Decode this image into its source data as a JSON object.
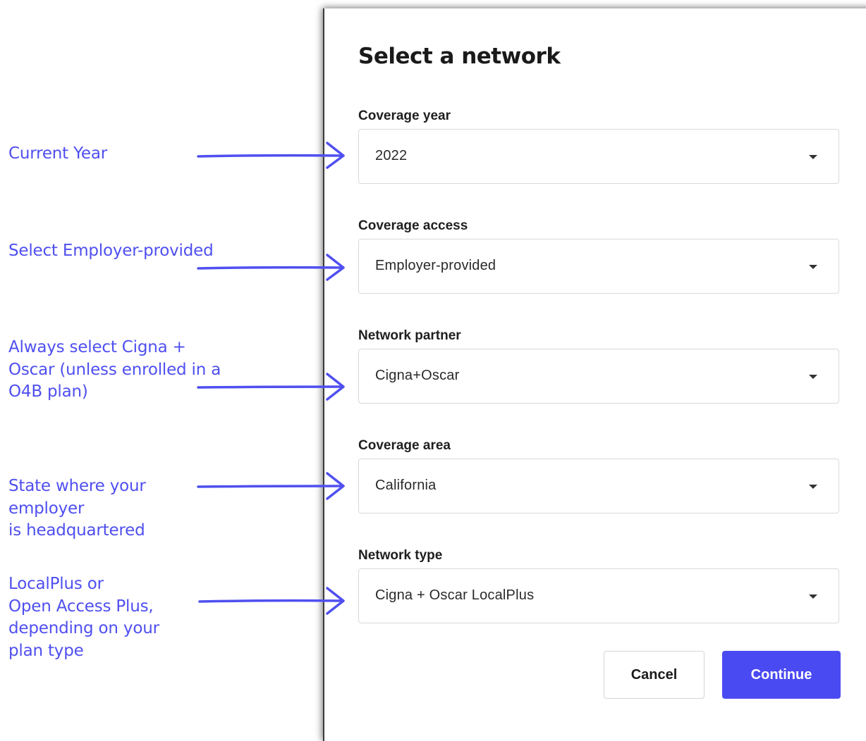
{
  "annotations": [
    {
      "name": "current-year",
      "lines": [
        "Current Year"
      ]
    },
    {
      "name": "employer-provided",
      "lines": [
        "Select Employer-provided"
      ]
    },
    {
      "name": "network-partner",
      "lines": [
        "Always select Cigna  +",
        "Oscar (unless enrolled in a",
        "O4B plan)"
      ]
    },
    {
      "name": "coverage-area",
      "lines": [
        "State where your",
        "employer",
        "is headquartered"
      ]
    },
    {
      "name": "network-type",
      "lines": [
        "LocalPlus or",
        "Open Access Plus,",
        "depending on your",
        "plan type"
      ]
    }
  ],
  "modal": {
    "title": "Select a network",
    "fields": [
      {
        "label": "Coverage year",
        "value": "2022"
      },
      {
        "label": "Coverage access",
        "value": "Employer-provided"
      },
      {
        "label": "Network partner",
        "value": "Cigna+Oscar"
      },
      {
        "label": "Coverage area",
        "value": "California"
      },
      {
        "label": "Network type",
        "value": "Cigna + Oscar LocalPlus"
      }
    ],
    "cancel_label": "Cancel",
    "continue_label": "Continue"
  },
  "colors": {
    "annotation": "#4f4ff0",
    "primary_button": "#4a4af2"
  },
  "icons": {
    "arrow": "right-arrow-icon",
    "dropdown": "caret-down-icon"
  }
}
